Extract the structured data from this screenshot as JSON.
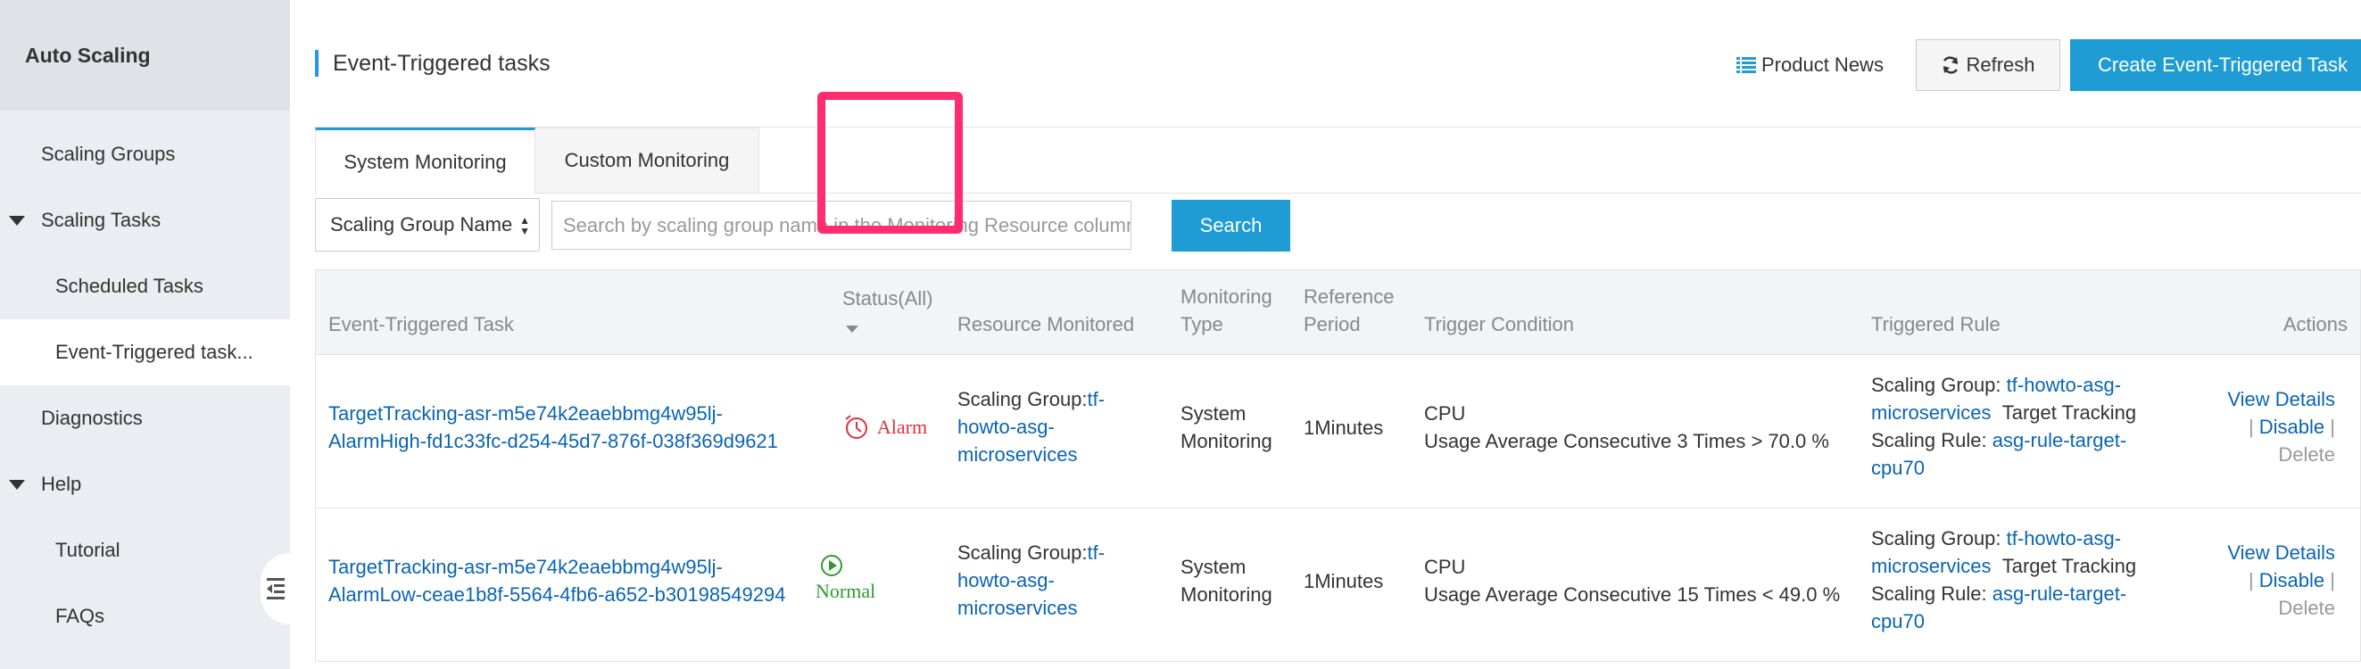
{
  "sidebar": {
    "title": "Auto Scaling",
    "items": [
      {
        "label": "Scaling Groups"
      },
      {
        "label": "Scaling Tasks"
      },
      {
        "label": "Scheduled Tasks"
      },
      {
        "label": "Event-Triggered task..."
      },
      {
        "label": "Diagnostics"
      },
      {
        "label": "Help"
      },
      {
        "label": "Tutorial"
      },
      {
        "label": "FAQs"
      }
    ]
  },
  "header": {
    "title": "Event-Triggered tasks",
    "product_news": "Product News",
    "refresh": "Refresh",
    "create": "Create Event-Triggered Task"
  },
  "tabs": [
    {
      "label": "System Monitoring"
    },
    {
      "label": "Custom Monitoring"
    }
  ],
  "search": {
    "select_value": "Scaling Group Name",
    "placeholder": "Search by scaling group name in the Monitoring Resource column",
    "button": "Search"
  },
  "table": {
    "columns": {
      "task": "Event-Triggered Task",
      "status": "Status(All)",
      "resource": "Resource Monitored",
      "monitoring_type_1": "Monitoring",
      "monitoring_type_2": "Type",
      "ref_period_1": "Reference",
      "ref_period_2": "Period",
      "trigger": "Trigger Condition",
      "rule": "Triggered Rule",
      "actions": "Actions"
    },
    "rows": [
      {
        "task_1": "TargetTracking-asr-m5e74k2eaebbmg4w95lj-",
        "task_2": "AlarmHigh-fd1c33fc-d254-45d7-876f-038f369d9621",
        "status": "Alarm",
        "resource_prefix": "Scaling Group:",
        "resource_1": "tf-",
        "resource_2": "howto-asg-",
        "resource_3": "microservices",
        "mtype_1": "System",
        "mtype_2": "Monitoring",
        "period": "1Minutes",
        "trigger_1": "CPU",
        "trigger_2": "Usage Average Consecutive 3 Times > 70.0 %",
        "rule_group_label": "Scaling Group: ",
        "rule_group_1": "tf-howto-asg-",
        "rule_group_2": "microservices",
        "rule_type": "Target Tracking",
        "rule_label": "Scaling Rule: ",
        "rule_1": "asg-rule-target-",
        "rule_2": "cpu70",
        "view": "View Details",
        "disable": "Disable",
        "delete": "Delete"
      },
      {
        "task_1": "TargetTracking-asr-m5e74k2eaebbmg4w95lj-",
        "task_2": "AlarmLow-ceae1b8f-5564-4fb6-a652-b30198549294",
        "status": "Normal",
        "resource_prefix": "Scaling Group:",
        "resource_1": "tf-",
        "resource_2": "howto-asg-",
        "resource_3": "microservices",
        "mtype_1": "System",
        "mtype_2": "Monitoring",
        "period": "1Minutes",
        "trigger_1": "CPU",
        "trigger_2": "Usage Average Consecutive 15 Times < 49.0 %",
        "rule_group_label": "Scaling Group: ",
        "rule_group_1": "tf-howto-asg-",
        "rule_group_2": "microservices",
        "rule_type": "Target Tracking",
        "rule_label": "Scaling Rule: ",
        "rule_1": "asg-rule-target-",
        "rule_2": "cpu70",
        "view": "View Details",
        "disable": "Disable",
        "delete": "Delete"
      }
    ]
  },
  "colors": {
    "accent": "#1e9cd3",
    "link": "#0a64b4",
    "alarm": "#e0303a",
    "normal": "#2e9a2e",
    "highlight": "#ff2d6f"
  }
}
